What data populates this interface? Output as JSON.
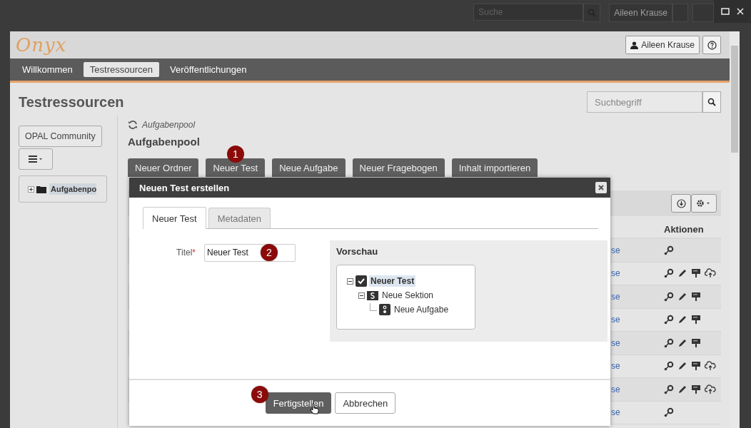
{
  "background_page": {
    "search": {
      "placeholder": "Suche"
    },
    "user_button": "Aileen Krause"
  },
  "header": {
    "logo": "Onyx",
    "user_button": "Aileen Krause"
  },
  "nav": {
    "tabs": [
      {
        "label": "Willkommen",
        "selected": false
      },
      {
        "label": "Testressourcen",
        "selected": true
      },
      {
        "label": "Veröffentlichungen",
        "selected": false
      }
    ]
  },
  "page_title": "Testressourcen",
  "search": {
    "placeholder": "Suchbegriff"
  },
  "sidebar": {
    "community_button": "OPAL Community",
    "tree": [
      {
        "label": "Aufgabenpo",
        "selected": true
      }
    ]
  },
  "breadcrumb": "Aufgabenpool",
  "heading": "Aufgabenpool",
  "actions": [
    {
      "label": "Neuer Ordner"
    },
    {
      "label": "Neuer Test",
      "badge": "1"
    },
    {
      "label": "Neue Aufgabe"
    },
    {
      "label": "Neuer Fragebogen"
    },
    {
      "label": "Inhalt importieren"
    }
  ],
  "table": {
    "columns": [
      {
        "label": "Aktionen"
      }
    ],
    "rows": [
      {
        "link": "se",
        "actions": [
          {
            "kind": "key"
          }
        ]
      },
      {
        "link": "se",
        "actions": [
          {
            "kind": "key"
          },
          {
            "kind": "pencil"
          },
          {
            "kind": "board"
          },
          {
            "kind": "cloud"
          }
        ]
      },
      {
        "link": "se",
        "actions": [
          {
            "kind": "key"
          },
          {
            "kind": "pencil"
          },
          {
            "kind": "board"
          }
        ]
      },
      {
        "link": "se",
        "actions": [
          {
            "kind": "key"
          },
          {
            "kind": "pencil"
          },
          {
            "kind": "board"
          }
        ]
      },
      {
        "link": "se",
        "actions": [
          {
            "kind": "key"
          },
          {
            "kind": "pencil"
          },
          {
            "kind": "board"
          }
        ]
      },
      {
        "link": "se",
        "actions": [
          {
            "kind": "key"
          },
          {
            "kind": "pencil"
          },
          {
            "kind": "board"
          },
          {
            "kind": "cloud"
          }
        ]
      },
      {
        "link": "se",
        "actions": [
          {
            "kind": "key"
          },
          {
            "kind": "pencil"
          },
          {
            "kind": "board"
          },
          {
            "kind": "cloud"
          }
        ]
      },
      {
        "link": "se",
        "actions": [
          {
            "kind": "key"
          }
        ]
      }
    ]
  },
  "dialog": {
    "title": "Neuen Test erstellen",
    "tabs": [
      {
        "label": "Neuer Test",
        "selected": true
      },
      {
        "label": "Metadaten",
        "selected": false
      }
    ],
    "field": {
      "label": "Titel",
      "required_mark": "*",
      "value": "Neuer Test",
      "badge": "2"
    },
    "preview": {
      "title": "Vorschau",
      "tree": [
        {
          "label": "Neuer Test",
          "kind": "test",
          "selected": true,
          "expanded": true,
          "children": [
            {
              "label": "Neue Sektion",
              "kind": "section",
              "selected": false,
              "expanded": true,
              "children": [
                {
                  "label": "Neue Aufgabe",
                  "kind": "item",
                  "selected": false
                }
              ]
            }
          ]
        }
      ]
    },
    "buttons": [
      {
        "label": "Fertigstellen",
        "kind": "primary",
        "badge": "3"
      },
      {
        "label": "Abbrechen",
        "kind": "secondary"
      }
    ]
  }
}
